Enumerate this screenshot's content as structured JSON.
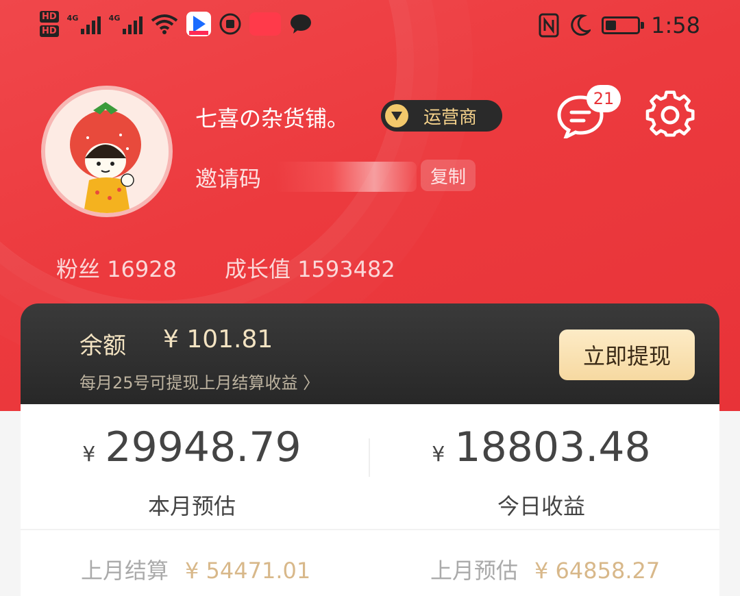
{
  "status_bar": {
    "time": "1:58",
    "network_1": "4G",
    "network_2": "4G",
    "hd_1": "HD",
    "hd_2": "HD",
    "battery_level": 0.35
  },
  "profile": {
    "name": "七喜の杂货铺。",
    "role_badge": "运营商",
    "invite_label": "邀请码",
    "copy_label": "复制",
    "message_count": "21",
    "fans_label": "粉丝",
    "fans_value": "16928",
    "growth_label": "成长值",
    "growth_value": "1593482"
  },
  "balance": {
    "label": "余额",
    "value": "¥ 101.81",
    "note": "每月25号可提现上月结算收益 〉",
    "withdraw_label": "立即提现"
  },
  "earnings": {
    "currency": "¥",
    "month_estimate_value": "29948.79",
    "month_estimate_label": "本月预估",
    "today_value": "18803.48",
    "today_label": "今日收益",
    "last_month_settled_label": "上月结算",
    "last_month_settled_value": "¥ 54471.01",
    "last_month_estimate_label": "上月预估",
    "last_month_estimate_value": "¥ 64858.27"
  },
  "colors": {
    "header_red": "#ec3a3e",
    "card_dark": "#2a2a2a",
    "gold": "#f3e3c2",
    "accent_gold": "#d8b88a"
  }
}
